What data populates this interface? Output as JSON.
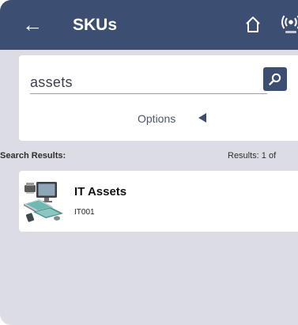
{
  "header": {
    "back_glyph": "←",
    "title": "SKUs",
    "icons": [
      "home-icon",
      "rfid-reader-icon"
    ]
  },
  "search": {
    "value": "assets",
    "options_label": "Options"
  },
  "results": {
    "label": "Search Results:",
    "count_text": "Results:  1  of"
  },
  "items": [
    {
      "name": "IT Assets",
      "code": "IT001",
      "icon": "it-assets-thumbnail"
    }
  ],
  "colors": {
    "appbar": "#3c4f72",
    "background": "#dcdde4",
    "card": "#ffffff"
  }
}
